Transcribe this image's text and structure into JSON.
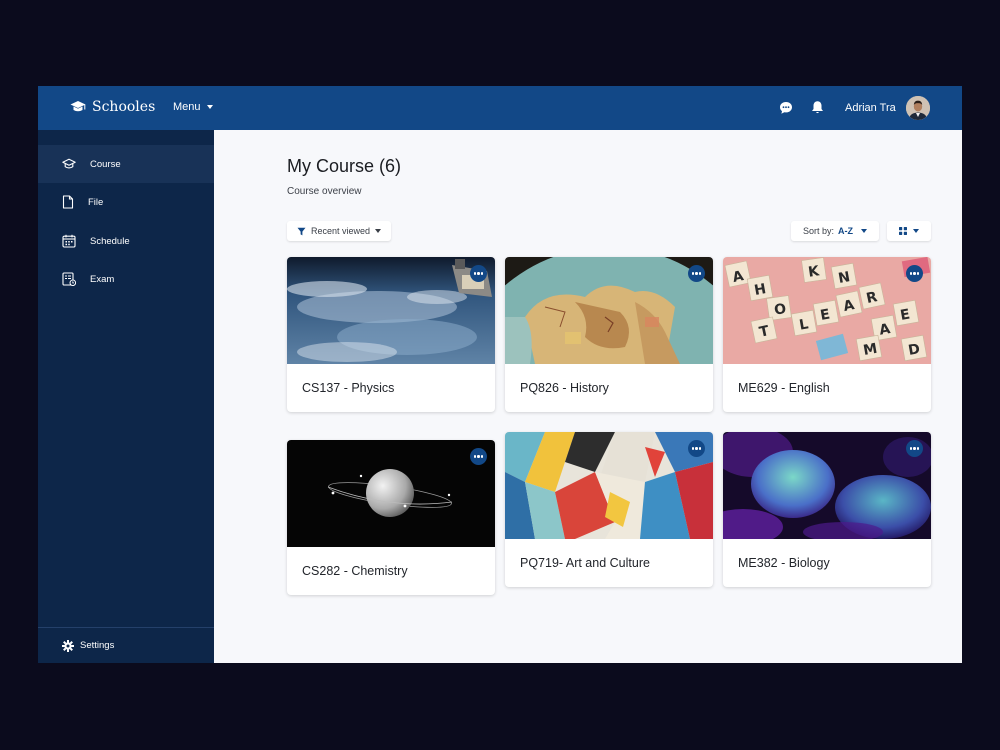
{
  "header": {
    "brand": "Schooles",
    "menu_label": "Menu",
    "user_name": "Adrian Tra"
  },
  "sidebar": {
    "items": [
      {
        "label": "Course",
        "icon": "graduation-cap-icon",
        "active": true
      },
      {
        "label": "File",
        "icon": "file-icon",
        "active": false
      },
      {
        "label": "Schedule",
        "icon": "calendar-icon",
        "active": false
      },
      {
        "label": "Exam",
        "icon": "exam-icon",
        "active": false
      }
    ],
    "settings_label": "Settings"
  },
  "main": {
    "title": "My Course (6)",
    "subtitle": "Course overview",
    "filter_label": "Recent viewed",
    "sort_prefix": "Sort by:",
    "sort_value": "A-Z",
    "courses": [
      {
        "title": "CS137 - Physics",
        "image": "earth-from-space"
      },
      {
        "title": "PQ826 - History",
        "image": "globe"
      },
      {
        "title": "ME629 - English",
        "image": "letter-tiles"
      },
      {
        "title": "CS282 - Chemistry",
        "image": "planet-with-rings"
      },
      {
        "title": "PQ719- Art and Culture",
        "image": "abstract-painting"
      },
      {
        "title": "ME382 - Biology",
        "image": "coral"
      }
    ]
  },
  "colors": {
    "primary": "#124887",
    "sidebar": "#0d2649",
    "sidebar_active": "#183257",
    "background": "#0b0b1d",
    "content": "#f7f8fb"
  }
}
